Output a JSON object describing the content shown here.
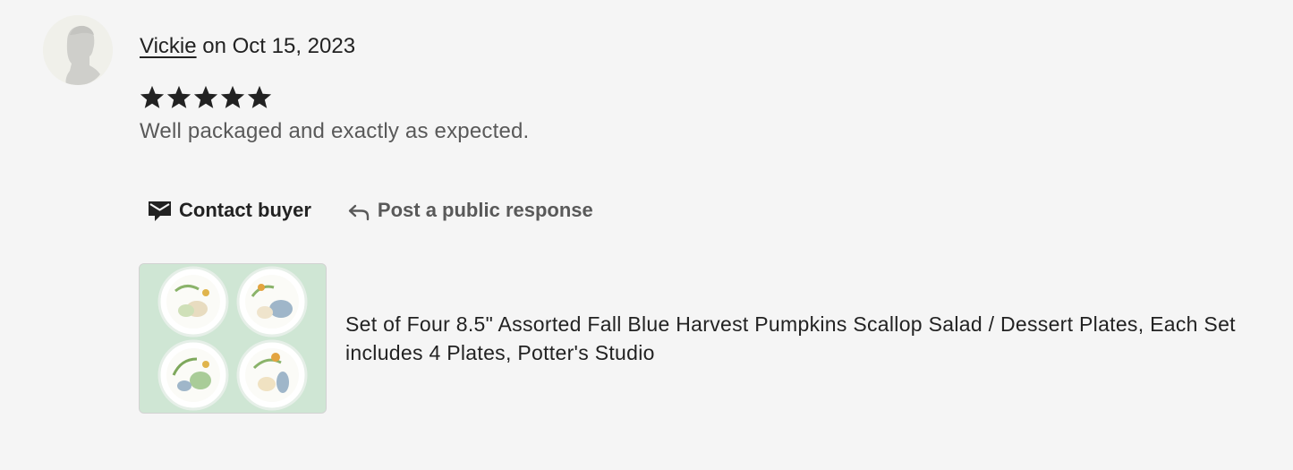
{
  "review": {
    "avatar_icon": "default-user-avatar-icon",
    "username": "Vickie",
    "date_prefix": "on",
    "date": "Oct 15, 2023",
    "rating": 5,
    "rating_max": 5,
    "text": "Well packaged and exactly as expected."
  },
  "actions": {
    "contact_icon": "envelope-icon",
    "contact_label": "Contact buyer",
    "respond_icon": "reply-arrow-icon",
    "respond_label": "Post a public response"
  },
  "product": {
    "thumbnail_icon": "pumpkin-plates-thumbnail",
    "title": "Set of Four 8.5\" Assorted Fall Blue Harvest Pumpkins Scallop Salad / Dessert Plates, Each Set includes 4 Plates, Potter's Studio"
  },
  "colors": {
    "text_primary": "#222222",
    "text_secondary": "#595959",
    "background": "#f5f5f5",
    "thumbnail_bg": "#cfe6d4"
  }
}
